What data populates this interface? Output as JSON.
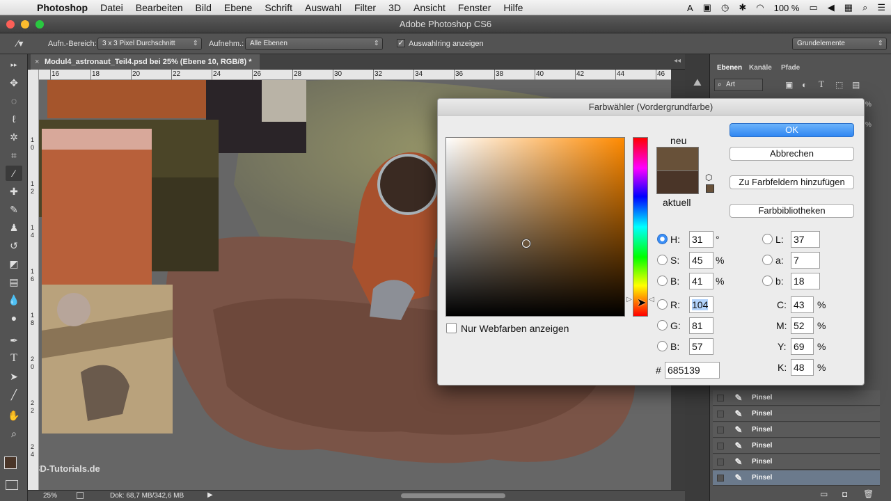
{
  "menubar": {
    "items": [
      "Photoshop",
      "Datei",
      "Bearbeiten",
      "Bild",
      "Ebene",
      "Schrift",
      "Auswahl",
      "Filter",
      "3D",
      "Ansicht",
      "Fenster",
      "Hilfe"
    ],
    "battery": "100 %"
  },
  "window": {
    "title": "Adobe Photoshop CS6"
  },
  "options": {
    "sample_area_label": "Aufn.-Bereich:",
    "sample_area_value": "3 x 3 Pixel Durchschnitt",
    "sample_label": "Aufnehm.:",
    "sample_value": "Alle Ebenen",
    "show_ring_label": "Auswahlring anzeigen",
    "workspace": "Grundelemente"
  },
  "document": {
    "tab": "Modul4_astronaut_Teil4.psd bei 25% (Ebene 10, RGB/8) *",
    "ruler_h": [
      "16",
      "18",
      "20",
      "22",
      "24",
      "26",
      "28",
      "30",
      "32",
      "34",
      "36",
      "38",
      "40",
      "42",
      "44",
      "46"
    ],
    "ruler_v": [
      "1 0",
      "1 2",
      "1 4",
      "1 6",
      "1 8",
      "2 0",
      "2 2",
      "2 4"
    ],
    "zoom": "25%",
    "doc_info": "Dok: 68,7 MB/342,6 MB",
    "watermark": "PSD-Tutorials.de"
  },
  "panels": {
    "tabs": [
      "Ebenen",
      "Kanäle",
      "Pfade"
    ],
    "filter_value": "Art",
    "opacity_tail": "%",
    "layers": [
      "Pinsel",
      "Pinsel",
      "Pinsel",
      "Pinsel",
      "Pinsel",
      "Pinsel"
    ]
  },
  "picker": {
    "title": "Farbwähler (Vordergrundfarbe)",
    "new_label": "neu",
    "current_label": "aktuell",
    "new_color": "#685139",
    "current_color": "#4a3528",
    "buttons": {
      "ok": "OK",
      "cancel": "Abbrechen",
      "add_swatch": "Zu Farbfeldern hinzufügen",
      "libraries": "Farbbibliotheken"
    },
    "web_colors_label": "Nur Webfarben anzeigen",
    "hsb": {
      "H": "31",
      "S": "45",
      "B": "41",
      "h_unit": "°",
      "pct": "%"
    },
    "rgb": {
      "R": "104",
      "G": "81",
      "B": "57"
    },
    "lab": {
      "L": "37",
      "a": "7",
      "b": "18"
    },
    "cmyk": {
      "C": "43",
      "M": "52",
      "Y": "69",
      "K": "48",
      "pct": "%"
    },
    "hex_label": "#",
    "hex": "685139",
    "labels": {
      "H": "H:",
      "S": "S:",
      "Bb": "B:",
      "R": "R:",
      "G": "G:",
      "Br": "B:",
      "L": "L:",
      "a": "a:",
      "b": "b:",
      "C": "C:",
      "M": "M:",
      "Y": "Y:",
      "K": "K:"
    }
  }
}
